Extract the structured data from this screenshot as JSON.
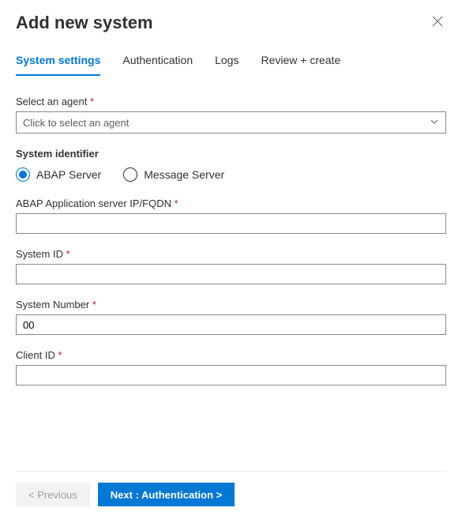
{
  "header": {
    "title": "Add new system"
  },
  "tabs": [
    {
      "label": "System settings",
      "active": true
    },
    {
      "label": "Authentication",
      "active": false
    },
    {
      "label": "Logs",
      "active": false
    },
    {
      "label": "Review + create",
      "active": false
    }
  ],
  "form": {
    "select_agent": {
      "label": "Select an agent",
      "required": true,
      "placeholder": "Click to select an agent",
      "value": ""
    },
    "system_identifier_heading": "System identifier",
    "server_type": {
      "options": [
        {
          "label": "ABAP Server",
          "value": "abap",
          "checked": true
        },
        {
          "label": "Message Server",
          "value": "message",
          "checked": false
        }
      ]
    },
    "abap_ip": {
      "label": "ABAP Application server IP/FQDN",
      "required": true,
      "value": ""
    },
    "system_id": {
      "label": "System ID",
      "required": true,
      "value": ""
    },
    "system_number": {
      "label": "System Number",
      "required": true,
      "value": "00"
    },
    "client_id": {
      "label": "Client ID",
      "required": true,
      "value": ""
    }
  },
  "footer": {
    "previous": "< Previous",
    "next": "Next : Authentication  >"
  },
  "required_marker": "*"
}
